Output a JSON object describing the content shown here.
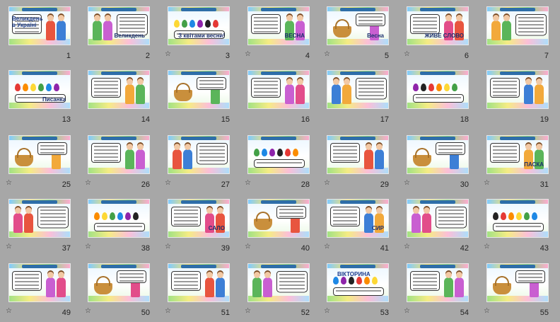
{
  "slides": [
    {
      "num": "1",
      "label": "Великдень в Україні",
      "star": false
    },
    {
      "num": "2",
      "label": "Великдень",
      "star": false
    },
    {
      "num": "3",
      "label": "З квітами весни!",
      "star": true
    },
    {
      "num": "4",
      "label": "ВЕСНА",
      "star": true
    },
    {
      "num": "5",
      "label": "Весна",
      "star": true
    },
    {
      "num": "6",
      "label": "ЖИВЕ СЛОВО",
      "star": true
    },
    {
      "num": "7",
      "label": "",
      "star": false
    },
    {
      "num": "13",
      "label": "Писанка",
      "star": false
    },
    {
      "num": "14",
      "label": "",
      "star": false
    },
    {
      "num": "15",
      "label": "",
      "star": false
    },
    {
      "num": "16",
      "label": "",
      "star": false
    },
    {
      "num": "17",
      "label": "",
      "star": false
    },
    {
      "num": "18",
      "label": "",
      "star": false
    },
    {
      "num": "19",
      "label": "",
      "star": false
    },
    {
      "num": "25",
      "label": "",
      "star": true
    },
    {
      "num": "26",
      "label": "",
      "star": true
    },
    {
      "num": "27",
      "label": "",
      "star": true
    },
    {
      "num": "28",
      "label": "",
      "star": true
    },
    {
      "num": "29",
      "label": "",
      "star": true
    },
    {
      "num": "30",
      "label": "",
      "star": true
    },
    {
      "num": "31",
      "label": "ПАСКА",
      "star": true
    },
    {
      "num": "37",
      "label": "",
      "star": true
    },
    {
      "num": "38",
      "label": "",
      "star": true
    },
    {
      "num": "39",
      "label": "САЛО",
      "star": true
    },
    {
      "num": "40",
      "label": "",
      "star": true
    },
    {
      "num": "41",
      "label": "СИР",
      "star": true
    },
    {
      "num": "42",
      "label": "",
      "star": true
    },
    {
      "num": "43",
      "label": "",
      "star": true
    },
    {
      "num": "49",
      "label": "",
      "star": true
    },
    {
      "num": "50",
      "label": "",
      "star": true
    },
    {
      "num": "51",
      "label": "",
      "star": true
    },
    {
      "num": "52",
      "label": "",
      "star": true
    },
    {
      "num": "53",
      "label": "ВІКТОРИНА",
      "star": true
    },
    {
      "num": "54",
      "label": "",
      "star": true
    },
    {
      "num": "55",
      "label": "",
      "star": true
    }
  ],
  "star_glyph": "☆",
  "colors": {
    "background": "#a7a7a7",
    "title": "#2e6ea8",
    "sky": "#eaf6ff",
    "grass": "#8fdc6b"
  }
}
